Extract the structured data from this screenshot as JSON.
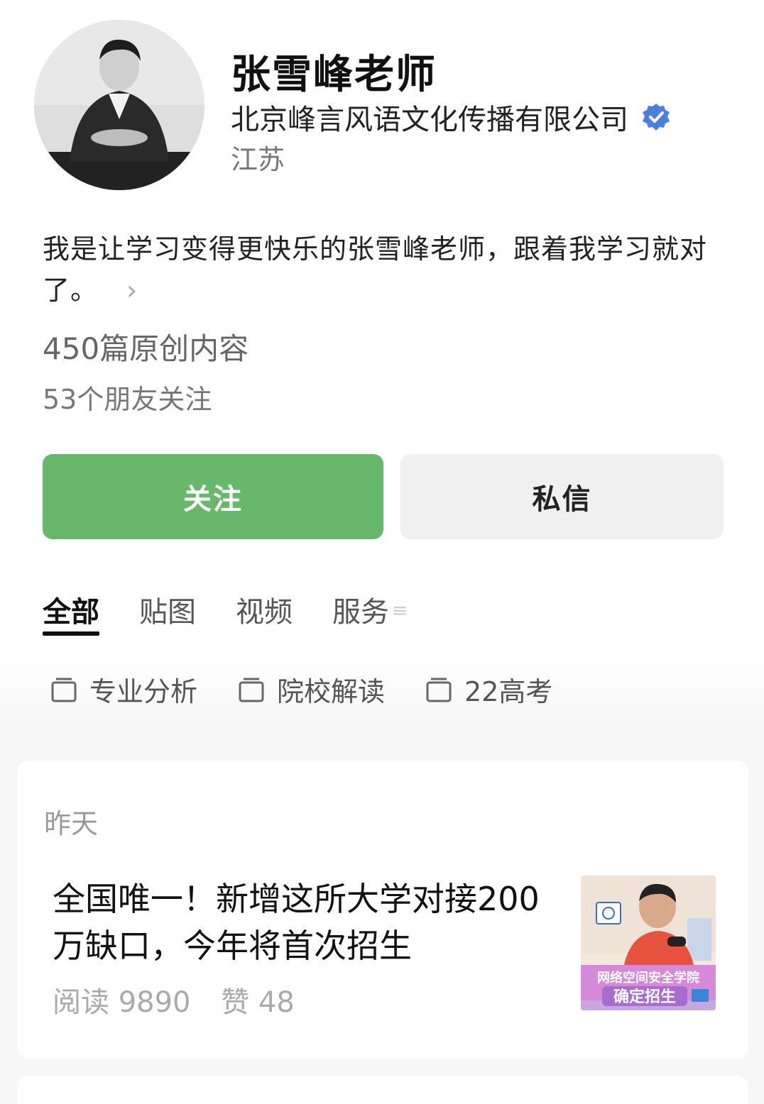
{
  "profile": {
    "name": "张雪峰老师",
    "company": "北京峰言风语文化传播有限公司",
    "region": "江苏",
    "bio": "我是让学习变得更快乐的张雪峰老师，跟着我学习就对了。",
    "articles": "450篇原创内容",
    "friends": "53个朋友关注"
  },
  "actions": {
    "follow": "关注",
    "message": "私信"
  },
  "tabs": [
    "全部",
    "贴图",
    "视频",
    "服务"
  ],
  "collections": [
    "专业分析",
    "院校解读",
    "22高考"
  ],
  "feed": {
    "date": "昨天",
    "title": "全国唯一！新增这所大学对接200万缺口，今年将首次招生",
    "reads": "阅读 9890",
    "likes": "赞 48",
    "thumb_text_top": "网络空间安全学院",
    "thumb_text_bottom": "确定招生"
  },
  "colors": {
    "accent": "#67b86b",
    "verified": "#4a7fe0"
  },
  "icons": {
    "verified": "verified-badge-icon",
    "collection": "folder-icon",
    "arrow": "chevron-right-icon",
    "tab_more": "menu-lines-icon"
  }
}
